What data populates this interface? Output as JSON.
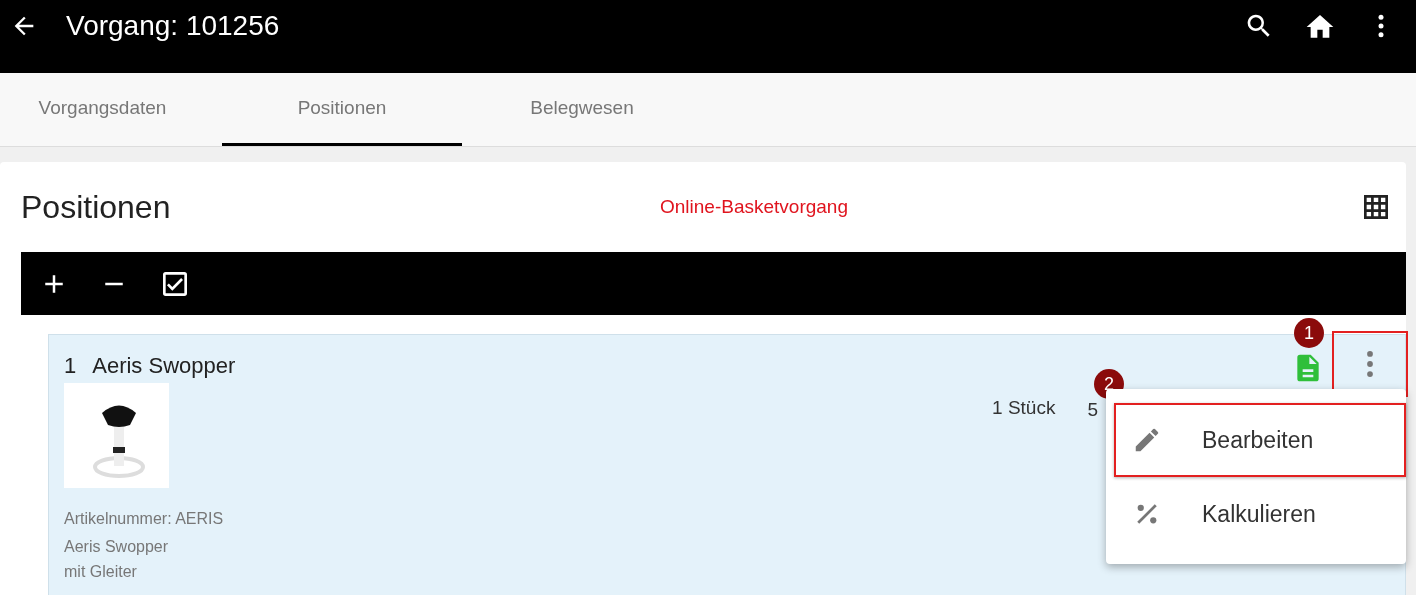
{
  "app_bar": {
    "title": "Vorgang: 101256"
  },
  "tabs": [
    {
      "label": "Vorgangsdaten",
      "selected": false
    },
    {
      "label": "Positionen",
      "selected": true
    },
    {
      "label": "Belegwesen",
      "selected": false
    }
  ],
  "card": {
    "title": "Positionen",
    "notice": "Online-Basketvorgang"
  },
  "positions": [
    {
      "number": "1",
      "name": "Aeris Swopper",
      "quantity": "1 Stück",
      "price_fragment": "5",
      "article_number": "Artikelnummer: AERIS",
      "description": [
        "Aeris Swopper",
        "mit Gleiter"
      ]
    }
  ],
  "menu": {
    "items": [
      {
        "label": "Bearbeiten",
        "kind": "edit",
        "highlighted": true
      },
      {
        "label": "Kalkulieren",
        "kind": "calc",
        "highlighted": false
      }
    ]
  },
  "callouts": [
    "1",
    "2"
  ]
}
